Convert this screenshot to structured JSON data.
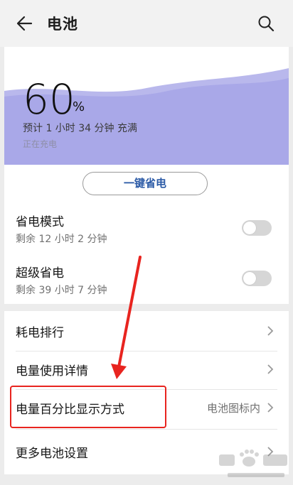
{
  "header": {
    "title": "电池",
    "back_icon": "arrow-left-icon",
    "search_icon": "search-icon"
  },
  "battery": {
    "percent": "60",
    "percent_sign": "%",
    "estimate": "预计 1 小时 34 分钟 充满",
    "status": "正在充电",
    "wave_color": "#a9a8e8"
  },
  "one_key_button": "一键省电",
  "modes": [
    {
      "title": "省电模式",
      "subtitle": "剩余 12 小时 2 分钟",
      "enabled": false
    },
    {
      "title": "超级省电",
      "subtitle": "剩余 39 小时 7 分钟",
      "enabled": false
    }
  ],
  "settings": [
    {
      "label": "耗电排行",
      "value": ""
    },
    {
      "label": "电量使用详情",
      "value": ""
    },
    {
      "label": "电量百分比显示方式",
      "value": "电池图标内"
    },
    {
      "label": "更多电池设置",
      "value": ""
    }
  ],
  "annotation": {
    "color": "#e8241f"
  },
  "watermark": {
    "text": "Bai 经验",
    "url": "jingyan.baidu.com"
  }
}
